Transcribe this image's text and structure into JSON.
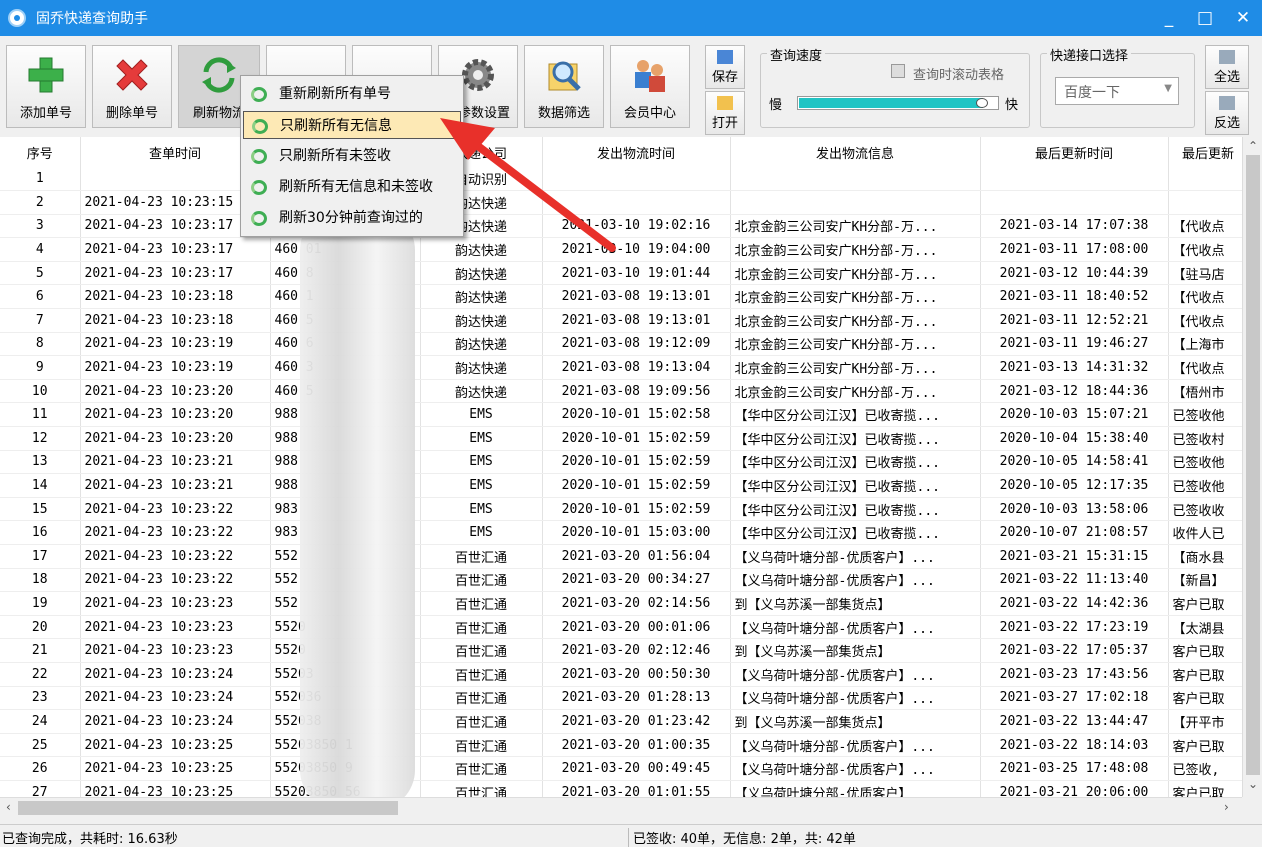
{
  "window": {
    "title": "固乔快递查询助手",
    "min": "_",
    "max": "□",
    "close": "✕"
  },
  "toolbar": {
    "add": "添加单号",
    "delete": "删除单号",
    "refresh": "刷新物流",
    "settings": "参数设置",
    "filter": "数据筛选",
    "member": "会员中心",
    "save": "保存",
    "open": "打开",
    "select_all": "全选",
    "invert": "反选"
  },
  "speed": {
    "title": "查询速度",
    "slow": "慢",
    "fast": "快",
    "scroll_label": "查询时滚动表格",
    "level": 0.95
  },
  "api": {
    "title": "快递接口选择",
    "selected": "百度一下"
  },
  "columns": [
    "序号",
    "查单时间",
    "单号",
    "快递公司",
    "发出物流时间",
    "发出物流信息",
    "最后更新时间",
    "最后更新"
  ],
  "rows": [
    [
      "1",
      "",
      "",
      "自动识别",
      "",
      "",
      "",
      ""
    ],
    [
      "2",
      "2021-04-23 10:23:15",
      "",
      "韵达快递",
      "",
      "",
      "",
      ""
    ],
    [
      "3",
      "2021-04-23 10:23:17",
      "",
      "韵达快递",
      "2021-03-10 19:02:16",
      "北京金韵三公司安广KH分部-万...",
      "2021-03-14 17:07:38",
      "【代收点"
    ],
    [
      "4",
      "2021-04-23 10:23:17",
      "460    01",
      "韵达快递",
      "2021-03-10 19:04:00",
      "北京金韵三公司安广KH分部-万...",
      "2021-03-11 17:08:00",
      "【代收点"
    ],
    [
      "5",
      "2021-04-23 10:23:17",
      "460     8",
      "韵达快递",
      "2021-03-10 19:01:44",
      "北京金韵三公司安广KH分部-万...",
      "2021-03-12 10:44:39",
      "【驻马店"
    ],
    [
      "6",
      "2021-04-23 10:23:18",
      "460     1",
      "韵达快递",
      "2021-03-08 19:13:01",
      "北京金韵三公司安广KH分部-万...",
      "2021-03-11 18:40:52",
      "【代收点"
    ],
    [
      "7",
      "2021-04-23 10:23:18",
      "460     5",
      "韵达快递",
      "2021-03-08 19:13:01",
      "北京金韵三公司安广KH分部-万...",
      "2021-03-11 12:52:21",
      "【代收点"
    ],
    [
      "8",
      "2021-04-23 10:23:19",
      "460     6",
      "韵达快递",
      "2021-03-08 19:12:09",
      "北京金韵三公司安广KH分部-万...",
      "2021-03-11 19:46:27",
      "【上海市"
    ],
    [
      "9",
      "2021-04-23 10:23:19",
      "460     3",
      "韵达快递",
      "2021-03-08 19:13:04",
      "北京金韵三公司安广KH分部-万...",
      "2021-03-13 14:31:32",
      "【代收点"
    ],
    [
      "10",
      "2021-04-23 10:23:20",
      "460     5",
      "韵达快递",
      "2021-03-08 19:09:56",
      "北京金韵三公司安广KH分部-万...",
      "2021-03-12 18:44:36",
      "【梧州市"
    ],
    [
      "11",
      "2021-04-23 10:23:20",
      "988",
      "EMS",
      "2020-10-01 15:02:58",
      "【华中区分公司江汉】已收寄揽...",
      "2020-10-03 15:07:21",
      "已签收他"
    ],
    [
      "12",
      "2021-04-23 10:23:20",
      "988",
      "EMS",
      "2020-10-01 15:02:59",
      "【华中区分公司江汉】已收寄揽...",
      "2020-10-04 15:38:40",
      "已签收村"
    ],
    [
      "13",
      "2021-04-23 10:23:21",
      "988",
      "EMS",
      "2020-10-01 15:02:59",
      "【华中区分公司江汉】已收寄揽...",
      "2020-10-05 14:58:41",
      "已签收他"
    ],
    [
      "14",
      "2021-04-23 10:23:21",
      "988",
      "EMS",
      "2020-10-01 15:02:59",
      "【华中区分公司江汉】已收寄揽...",
      "2020-10-05 12:17:35",
      "已签收他"
    ],
    [
      "15",
      "2021-04-23 10:23:22",
      "983",
      "EMS",
      "2020-10-01 15:02:59",
      "【华中区分公司江汉】已收寄揽...",
      "2020-10-03 13:58:06",
      "已签收收"
    ],
    [
      "16",
      "2021-04-23 10:23:22",
      "983",
      "EMS",
      "2020-10-01 15:03:00",
      "【华中区分公司江汉】已收寄揽...",
      "2020-10-07 21:08:57",
      "收件人已"
    ],
    [
      "17",
      "2021-04-23 10:23:22",
      "552",
      "百世汇通",
      "2021-03-20 01:56:04",
      "【义乌荷叶塘分部-优质客户】...",
      "2021-03-21 15:31:15",
      "【商水县"
    ],
    [
      "18",
      "2021-04-23 10:23:22",
      "552",
      "百世汇通",
      "2021-03-20 00:34:27",
      "【义乌荷叶塘分部-优质客户】...",
      "2021-03-22 11:13:40",
      "【新昌】"
    ],
    [
      "19",
      "2021-04-23 10:23:23",
      "552",
      "百世汇通",
      "2021-03-20 02:14:56",
      "到【义乌苏溪一部集货点】",
      "2021-03-22 14:42:36",
      "客户已取"
    ],
    [
      "20",
      "2021-04-23 10:23:23",
      "5520",
      "百世汇通",
      "2021-03-20 00:01:06",
      "【义乌荷叶塘分部-优质客户】...",
      "2021-03-22 17:23:19",
      "【太湖县"
    ],
    [
      "21",
      "2021-04-23 10:23:23",
      "5520",
      "百世汇通",
      "2021-03-20 02:12:46",
      "到【义乌苏溪一部集货点】",
      "2021-03-22 17:05:37",
      "客户已取"
    ],
    [
      "22",
      "2021-04-23 10:23:24",
      "55203",
      "百世汇通",
      "2021-03-20 00:50:30",
      "【义乌荷叶塘分部-优质客户】...",
      "2021-03-23 17:43:56",
      "客户已取"
    ],
    [
      "23",
      "2021-04-23 10:23:24",
      "552036",
      "百世汇通",
      "2021-03-20 01:28:13",
      "【义乌荷叶塘分部-优质客户】...",
      "2021-03-27 17:02:18",
      "客户已取"
    ],
    [
      "24",
      "2021-04-23 10:23:24",
      "552038",
      "百世汇通",
      "2021-03-20 01:23:42",
      "到【义乌苏溪一部集货点】",
      "2021-03-22 13:44:47",
      "【开平市"
    ],
    [
      "25",
      "2021-04-23 10:23:25",
      "55203850    1",
      "百世汇通",
      "2021-03-20 01:00:35",
      "【义乌荷叶塘分部-优质客户】...",
      "2021-03-22 18:14:03",
      "客户已取"
    ],
    [
      "26",
      "2021-04-23 10:23:25",
      "55203850    9",
      "百世汇通",
      "2021-03-20 00:49:45",
      "【义乌荷叶塘分部-优质客户】...",
      "2021-03-25 17:48:08",
      "已签收,"
    ],
    [
      "27",
      "2021-04-23 10:23:25",
      "55203850   56",
      "百世汇通",
      "2021-03-20 01:01:55",
      "【义乌荷叶塘分部-优质客户】",
      "2021-03-21 20:06:00",
      "客户已取"
    ]
  ],
  "menu": [
    "重新刷新所有单号",
    "只刷新所有无信息",
    "只刷新所有未签收",
    "刷新所有无信息和未签收",
    "刷新30分钟前查询过的"
  ],
  "status": {
    "left": "已查询完成，共耗时: 16.63秒",
    "right": "已签收: 40单，无信息: 2单，共: 42单"
  },
  "icons": {
    "add": "green-plus-icon",
    "delete": "red-x-icon",
    "refresh": "refresh-arrows-icon",
    "settings": "gear-icon",
    "filter": "magnifier-icon",
    "member": "users-icon"
  }
}
